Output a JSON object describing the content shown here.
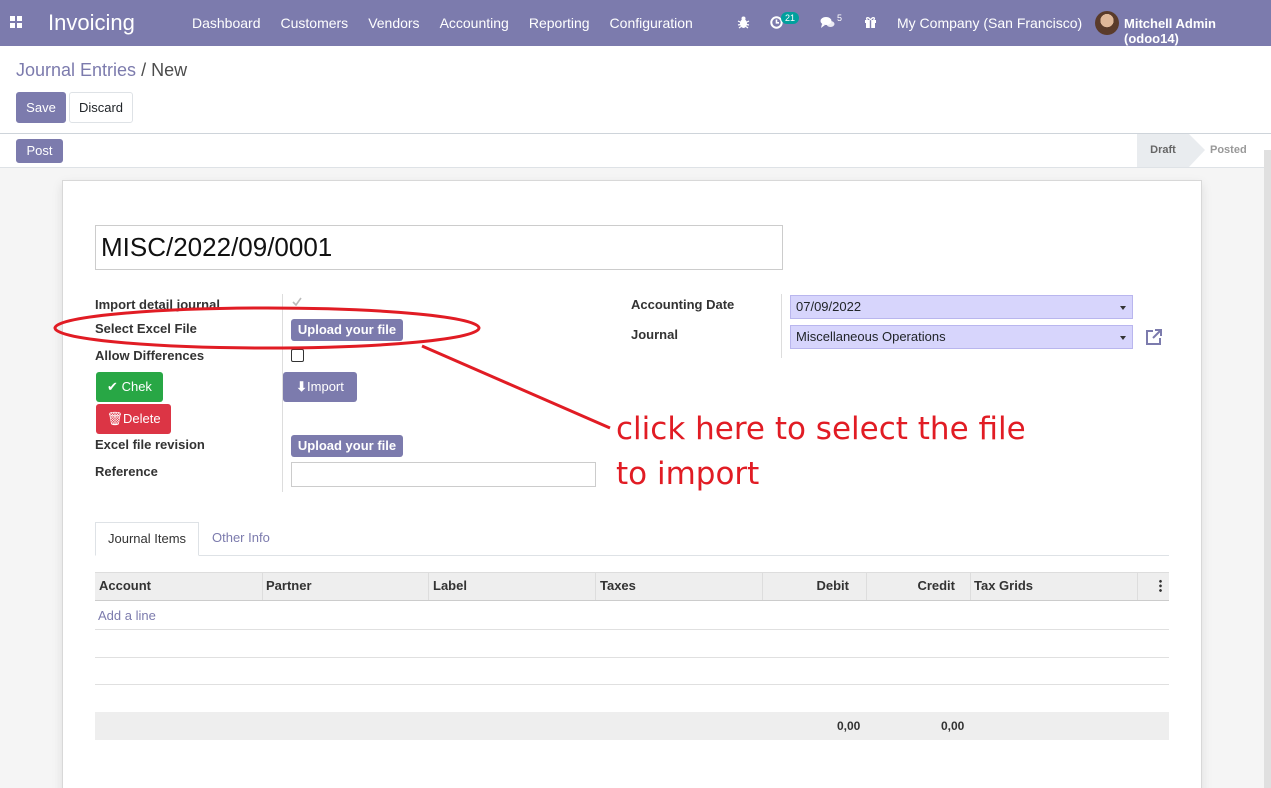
{
  "navbar": {
    "brand": "Invoicing",
    "menu": [
      "Dashboard",
      "Customers",
      "Vendors",
      "Accounting",
      "Reporting",
      "Configuration"
    ],
    "activity_count": "21",
    "messages_count": "5",
    "company": "My Company (San Francisco)",
    "user": "Mitchell Admin (odoo14)"
  },
  "breadcrumb": {
    "parent": "Journal Entries",
    "separator": "/",
    "current": "New"
  },
  "actions": {
    "save": "Save",
    "discard": "Discard",
    "post": "Post"
  },
  "statusbar": {
    "draft": "Draft",
    "posted": "Posted"
  },
  "form": {
    "name": "MISC/2022/09/0001",
    "import_detail_journal": "Import detail journal",
    "select_excel_file": "Select Excel File",
    "upload_label": "Upload your file",
    "allow_differences": "Allow Differences",
    "check_button": "Chek",
    "delete_button": "Delete",
    "import_button": "Import",
    "excel_file_revision": "Excel file revision",
    "reference": "Reference",
    "accounting_date_label": "Accounting Date",
    "accounting_date": "07/09/2022",
    "journal_label": "Journal",
    "journal": "Miscellaneous Operations"
  },
  "tabs": [
    "Journal Items",
    "Other Info"
  ],
  "table": {
    "columns": [
      "Account",
      "Partner",
      "Label",
      "Taxes",
      "Debit",
      "Credit",
      "Tax Grids"
    ],
    "add_line": "Add a line",
    "debit_total": "0,00",
    "credit_total": "0,00"
  },
  "annotation": {
    "line1": "click here to select the file",
    "line2": "to import",
    "color": "#e11c24"
  },
  "colors": {
    "brand": "#7c7bad",
    "success": "#28a745",
    "danger": "#dc3545"
  }
}
